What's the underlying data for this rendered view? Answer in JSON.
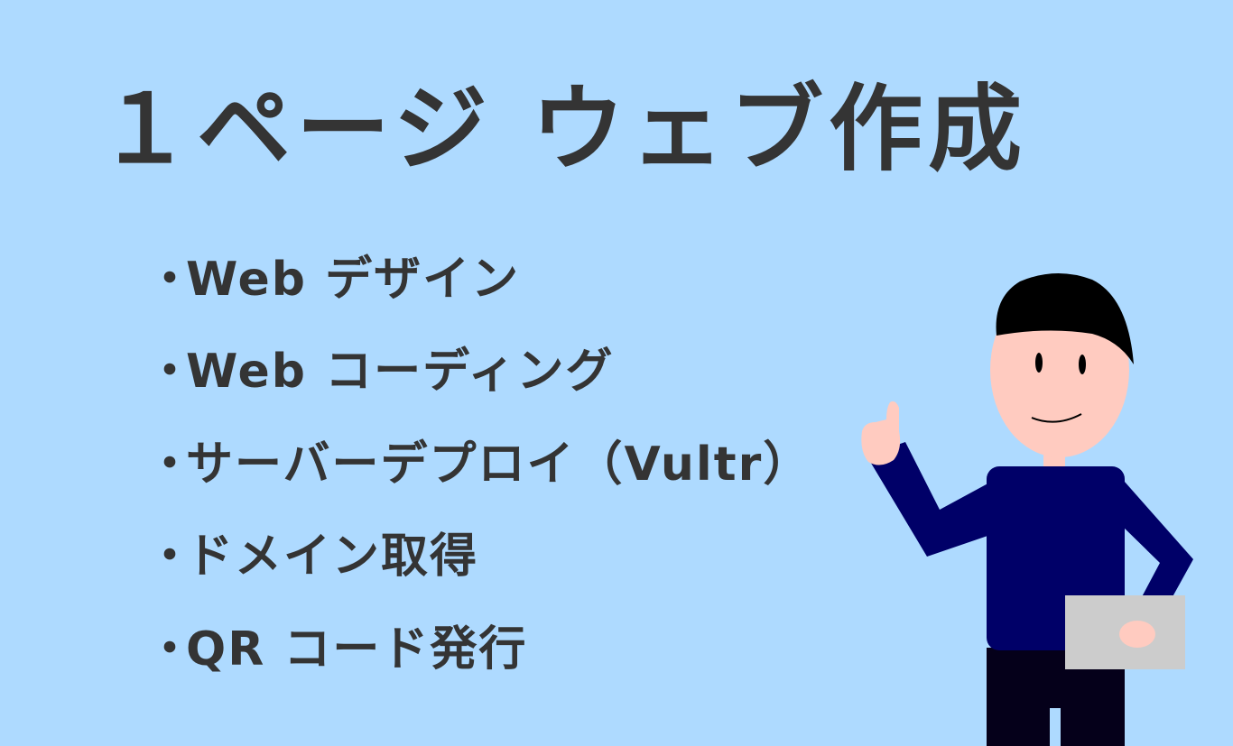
{
  "title": "１ページ ウェブ作成",
  "items": [
    {
      "bullet": "・",
      "label": "Web デザイン"
    },
    {
      "bullet": "・",
      "label": "Web コーディング"
    },
    {
      "bullet": "・",
      "label": "サーバーデプロイ（Vultr）"
    },
    {
      "bullet": "・",
      "label": "ドメイン取得"
    },
    {
      "bullet": "・",
      "label": "QR コード発行"
    }
  ],
  "colors": {
    "background": "#aedaff",
    "text": "#343434",
    "shirt": "#000068",
    "pants": "#05001a",
    "skin": "#ffcbc0",
    "hair": "#000000",
    "clipboard": "#cccccc"
  }
}
